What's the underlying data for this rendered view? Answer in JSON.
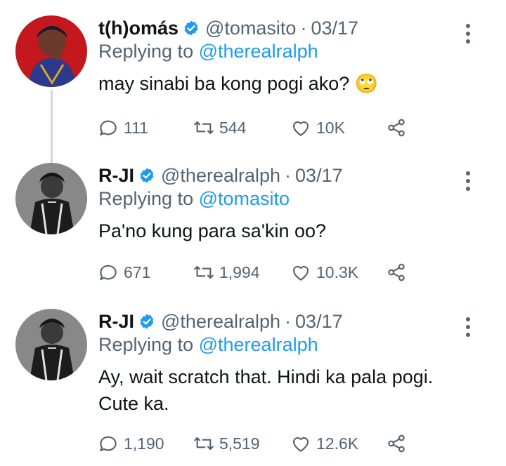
{
  "tweets": [
    {
      "name": "t(h)omás",
      "handle": "@tomasito",
      "separator": "·",
      "date": "03/17",
      "replying_prefix": "Replying to",
      "replying_to": "@therealralph",
      "text": "may sinabi ba kong pogi ako?",
      "emoji": "🙄",
      "replies": "111",
      "retweets": "544",
      "likes": "10K",
      "avatar_colors": [
        "#c2181e",
        "#1a1a2e"
      ]
    },
    {
      "name": "R-JI",
      "handle": "@therealralph",
      "separator": "·",
      "date": "03/17",
      "replying_prefix": "Replying to",
      "replying_to": "@tomasito",
      "text": "Pa'no kung para sa'kin oo?",
      "replies": "671",
      "retweets": "1,994",
      "likes": "10.3K",
      "avatar_colors": [
        "#8a8a8a",
        "#1c1c1c"
      ]
    },
    {
      "name": "R-JI",
      "handle": "@therealralph",
      "separator": "·",
      "date": "03/17",
      "replying_prefix": "Replying to",
      "replying_to": "@therealralph",
      "text_line1": "Ay, wait scratch that. Hindi ka pala pogi.",
      "text_line2": "Cute ka.",
      "replies": "1,190",
      "retweets": "5,519",
      "likes": "12.6K",
      "avatar_colors": [
        "#8a8a8a",
        "#1c1c1c"
      ]
    }
  ],
  "colors": {
    "text": "#0f1419",
    "secondary": "#536471",
    "link": "#1d9bf0",
    "verified": "#1d9bf0"
  },
  "icons": [
    "reply-icon",
    "retweet-icon",
    "like-icon",
    "share-icon",
    "verified-badge-icon",
    "more-options-icon"
  ]
}
